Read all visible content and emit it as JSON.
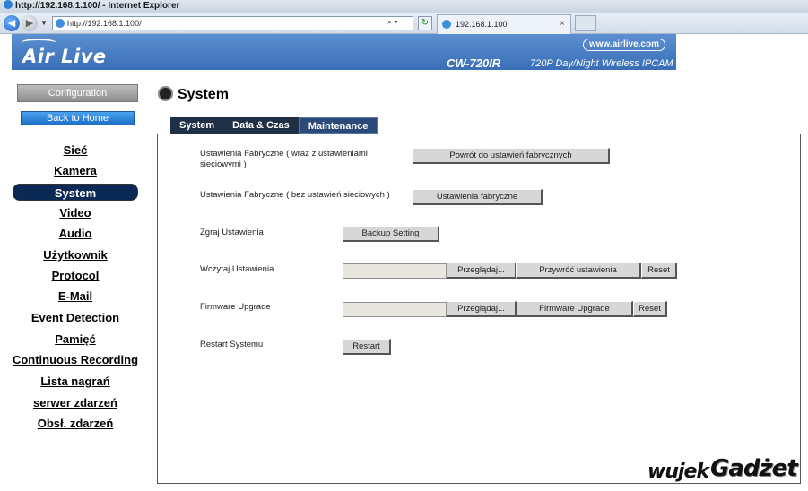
{
  "window": {
    "title": "http://192.168.1.100/ - Internet Explorer",
    "address": "http://192.168.1.100/",
    "tab_title": "192.168.1.100",
    "tab_close": "×"
  },
  "header": {
    "logo": "Air Live",
    "url": "www.airlive.com",
    "model": "CW-720IR",
    "model_desc": "720P Day/Night Wireless IPCAM"
  },
  "sidebar": {
    "config_button": "Configuration",
    "home_button": "Back to Home",
    "items": [
      {
        "label": "Sieć"
      },
      {
        "label": "Kamera"
      },
      {
        "label": "System"
      },
      {
        "label": "Video"
      },
      {
        "label": "Audio"
      },
      {
        "label": "Użytkownik"
      },
      {
        "label": "Protocol"
      },
      {
        "label": "E-Mail"
      },
      {
        "label": "Event Detection"
      },
      {
        "label": "Pamięć"
      },
      {
        "label": "Continuous Recording"
      },
      {
        "label": "Lista nagrań"
      },
      {
        "label": "serwer zdarzeń"
      },
      {
        "label": "Obsł. zdarzeń"
      }
    ],
    "active_index": 2
  },
  "main": {
    "title": "System",
    "tabs": [
      {
        "label": "System"
      },
      {
        "label": "Data & Czas"
      },
      {
        "label": "Maintenance"
      }
    ],
    "active_tab": 2,
    "rows": {
      "factory_full_label": "Ustawienia Fabryczne ( wraz z ustawieniami sieciowymi )",
      "factory_full_button": "Powrót do ustawień fabrycznych",
      "factory_partial_label": "Ustawienia Fabryczne ( bez ustawień sieciowych )",
      "factory_partial_button": "Ustawienia fabryczne",
      "backup_label": "Zgraj Ustawienia",
      "backup_button": "Backup Setting",
      "restore_label": "Wczytaj Ustawienia",
      "restore_browse": "Przeglądaj...",
      "restore_button": "Przywróć ustawienia",
      "restore_reset": "Reset",
      "firmware_label": "Firmware Upgrade",
      "firmware_browse": "Przeglądaj...",
      "firmware_button": "Firmware Upgrade",
      "firmware_reset": "Reset",
      "restart_label": "Restart Systemu",
      "restart_button": "Restart"
    }
  },
  "watermark": {
    "part1": "wujek",
    "part2": "Gadżet"
  },
  "colors": {
    "banner": "#3a6fb8",
    "active_menu": "#0a2a55",
    "tab_bar": "#1f2f45"
  }
}
